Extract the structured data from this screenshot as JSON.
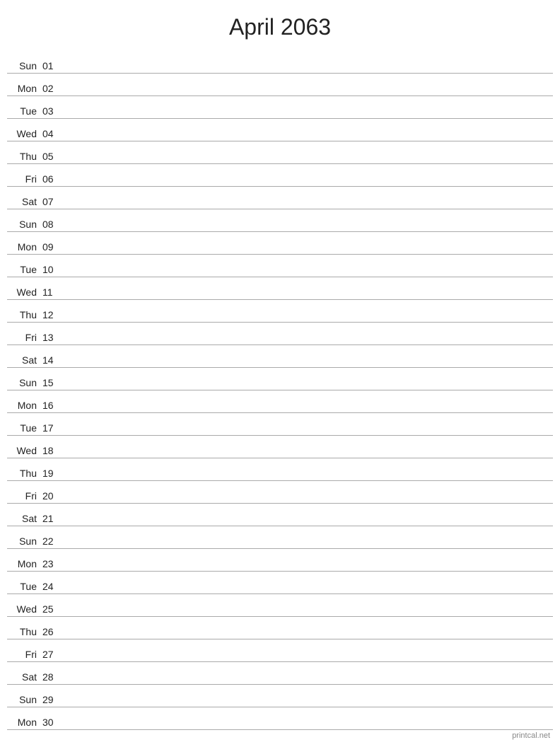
{
  "header": {
    "title": "April 2063"
  },
  "days": [
    {
      "name": "Sun",
      "number": "01"
    },
    {
      "name": "Mon",
      "number": "02"
    },
    {
      "name": "Tue",
      "number": "03"
    },
    {
      "name": "Wed",
      "number": "04"
    },
    {
      "name": "Thu",
      "number": "05"
    },
    {
      "name": "Fri",
      "number": "06"
    },
    {
      "name": "Sat",
      "number": "07"
    },
    {
      "name": "Sun",
      "number": "08"
    },
    {
      "name": "Mon",
      "number": "09"
    },
    {
      "name": "Tue",
      "number": "10"
    },
    {
      "name": "Wed",
      "number": "11"
    },
    {
      "name": "Thu",
      "number": "12"
    },
    {
      "name": "Fri",
      "number": "13"
    },
    {
      "name": "Sat",
      "number": "14"
    },
    {
      "name": "Sun",
      "number": "15"
    },
    {
      "name": "Mon",
      "number": "16"
    },
    {
      "name": "Tue",
      "number": "17"
    },
    {
      "name": "Wed",
      "number": "18"
    },
    {
      "name": "Thu",
      "number": "19"
    },
    {
      "name": "Fri",
      "number": "20"
    },
    {
      "name": "Sat",
      "number": "21"
    },
    {
      "name": "Sun",
      "number": "22"
    },
    {
      "name": "Mon",
      "number": "23"
    },
    {
      "name": "Tue",
      "number": "24"
    },
    {
      "name": "Wed",
      "number": "25"
    },
    {
      "name": "Thu",
      "number": "26"
    },
    {
      "name": "Fri",
      "number": "27"
    },
    {
      "name": "Sat",
      "number": "28"
    },
    {
      "name": "Sun",
      "number": "29"
    },
    {
      "name": "Mon",
      "number": "30"
    }
  ],
  "footer": {
    "label": "printcal.net"
  }
}
